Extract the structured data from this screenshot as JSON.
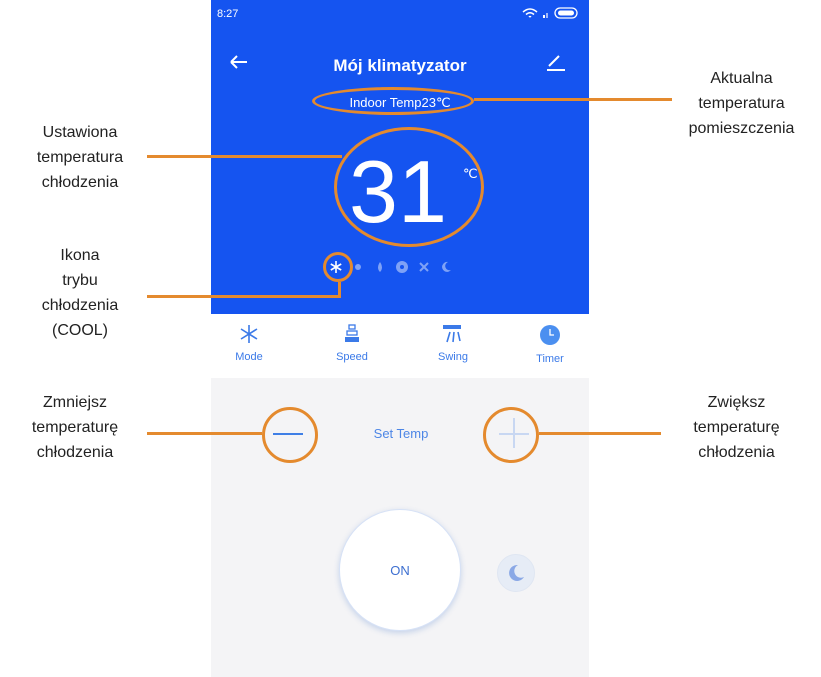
{
  "status": {
    "time": "8:27"
  },
  "header": {
    "title": "Mój klimatyzator",
    "indoor_temp": "Indoor Temp23℃"
  },
  "display": {
    "temperature": "31",
    "unit": "℃"
  },
  "modes": [
    "cool-icon",
    "sun-icon",
    "drop-icon",
    "fan-icon",
    "auto-icon",
    "moon-icon"
  ],
  "actions": {
    "mode": "Mode",
    "speed": "Speed",
    "swing": "Swing",
    "timer": "Timer"
  },
  "controls": {
    "set_temp": "Set Temp",
    "power": "ON"
  },
  "annotations": {
    "current_temp": [
      "Aktualna",
      "temperatura",
      "pomieszczenia"
    ],
    "set_temp": [
      "Ustawiona",
      "temperatura",
      "chłodzenia"
    ],
    "cool_icon": [
      "Ikona",
      "trybu",
      "chłodzenia",
      "(COOL)"
    ],
    "decrease": [
      "Zmniejsz",
      "temperaturę",
      "chłodzenia"
    ],
    "increase": [
      "Zwiększ",
      "temperaturę",
      "chłodzenia"
    ]
  },
  "colors": {
    "primary_blue": "#1554f0",
    "annotation_orange": "#e48a2e",
    "accent_blue": "#3b7ae8"
  }
}
